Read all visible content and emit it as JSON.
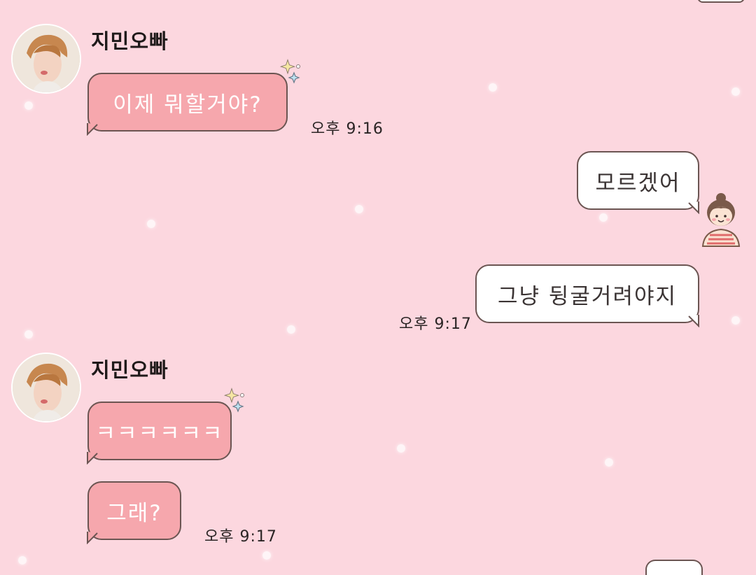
{
  "contact": {
    "name": "지민오빠"
  },
  "messages": [
    {
      "direction": "incoming",
      "sender": "지민오빠",
      "text": "이제 뭐할거야?",
      "time": "오후 9:16"
    },
    {
      "direction": "outgoing",
      "text": "모르겠어",
      "time": ""
    },
    {
      "direction": "outgoing",
      "text": "그냥 뒹굴거려야지",
      "time": "오후 9:17"
    },
    {
      "direction": "incoming",
      "sender": "지민오빠",
      "text": "ㅋㅋㅋㅋㅋㅋ",
      "time": ""
    },
    {
      "direction": "incoming",
      "sender": "지민오빠",
      "text": "그래?",
      "time": "오후 9:17"
    }
  ],
  "icons": {
    "contact_avatar": "profile-photo",
    "sparkle": "sparkle-icon",
    "self_avatar": "girl-sticker-icon"
  },
  "colors": {
    "background": "#fcd7df",
    "incoming_bubble": "#f6a7ad",
    "outgoing_bubble": "#ffffff",
    "bubble_border": "#6b5552"
  }
}
